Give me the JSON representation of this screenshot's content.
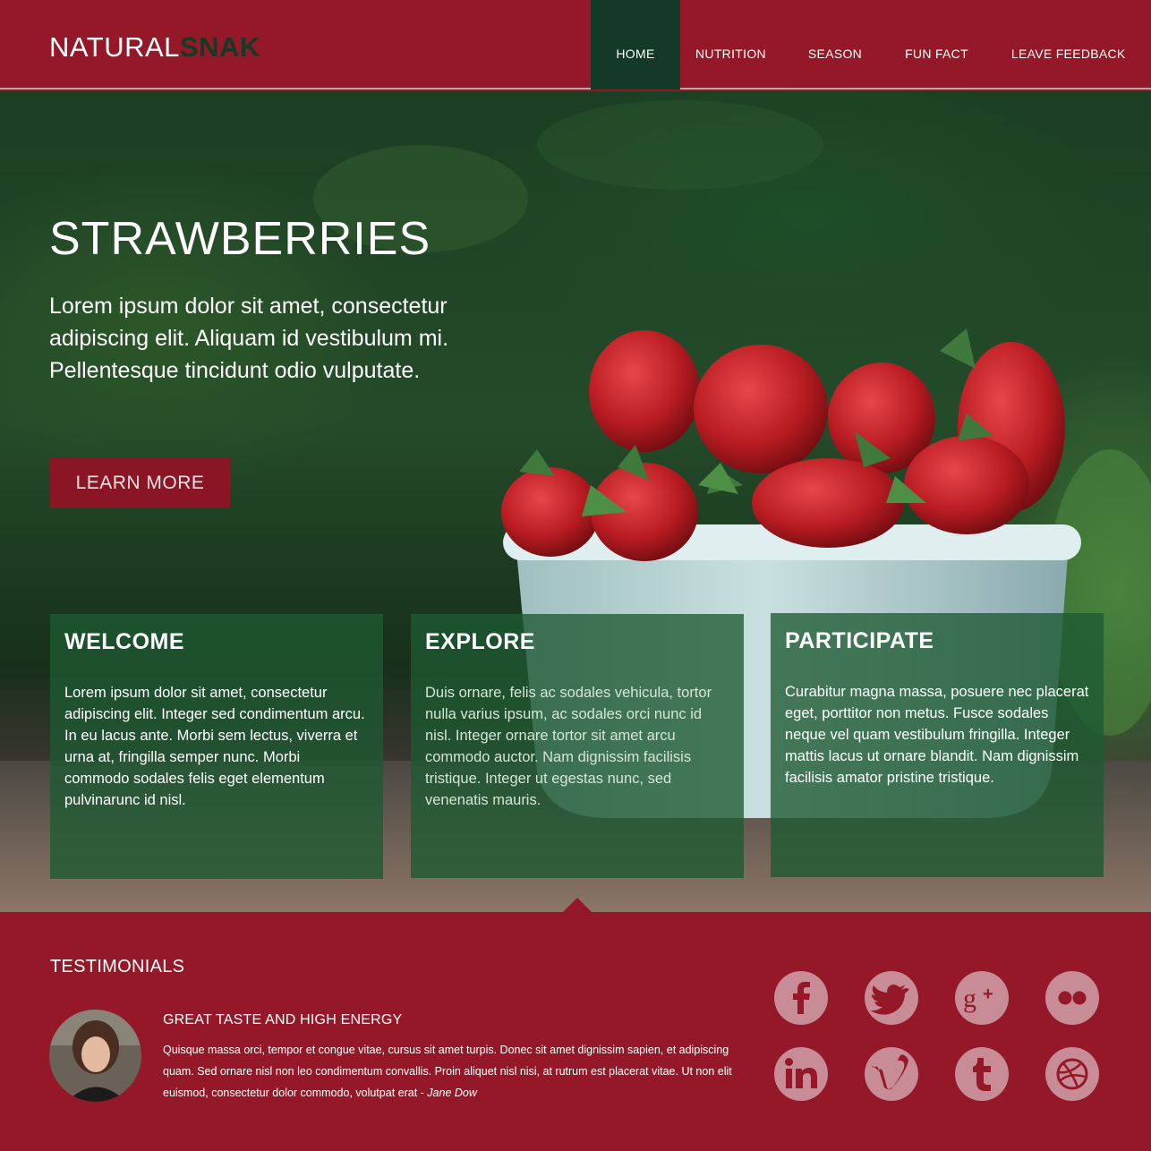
{
  "logo": {
    "part1": "NATURAL",
    "part2": "SNAK"
  },
  "nav": {
    "items": [
      {
        "label": "HOME"
      },
      {
        "label": "NUTRITION"
      },
      {
        "label": "SEASON"
      },
      {
        "label": "FUN FACT"
      },
      {
        "label": "LEAVE FEEDBACK"
      }
    ],
    "active": "HOME"
  },
  "hero": {
    "title": "STRAWBERRIES",
    "text": "Lorem ipsum dolor sit amet, consectetur adipiscing elit. Aliquam id vestibulum mi. Pellentesque tincidunt odio vulputate.",
    "button_label": "LEARN MORE"
  },
  "cards": [
    {
      "title": "WELCOME",
      "text": "Lorem ipsum dolor sit amet, consectetur adipiscing elit. Integer sed condimentum arcu. In eu lacus ante. Morbi sem lectus, viverra et urna at, fringilla semper nunc. Morbi commodo sodales felis eget elementum pulvinarunc id nisl."
    },
    {
      "title": "EXPLORE",
      "text": "Duis ornare, felis ac sodales vehicula, tortor nulla varius ipsum, ac sodales orci nunc id nisl. Integer ornare tortor sit amet arcu commodo auctor. Nam dignissim facilisis tristique. Integer ut egestas nunc, sed venenatis mauris."
    },
    {
      "title": "PARTICIPATE",
      "text": "Curabitur magna massa, posuere nec placerat eget, porttitor non metus. Fusce sodales neque vel quam vestibulum fringilla. Integer mattis lacus ut ornare blandit. Nam dignissim facilisis amator pristine tristique."
    }
  ],
  "testimonials": {
    "title": "TESTIMONIALS",
    "heading": "GREAT TASTE AND HIGH ENERGY",
    "text": "Quisque massa orci, tempor et congue vitae, cursus sit amet turpis. Donec sit amet dignissim sapien, et adipiscing quam. Sed ornare nisl non leo condimentum convallis. Proin aliquet nisl nisi, at rutrum est placerat vitae. Ut non elit euismod, consectetur dolor commodo, volutpat erat - ",
    "author": "Jane Dow"
  },
  "social": [
    "facebook-icon",
    "twitter-icon",
    "google-plus-icon",
    "flickr-icon",
    "linkedin-icon",
    "vimeo-icon",
    "tumblr-icon",
    "dribbble-icon"
  ],
  "colors": {
    "brand_red": "#951828",
    "brand_green": "#123a26",
    "card_green": "#1e5a32",
    "social_pink": "#c88c97"
  }
}
